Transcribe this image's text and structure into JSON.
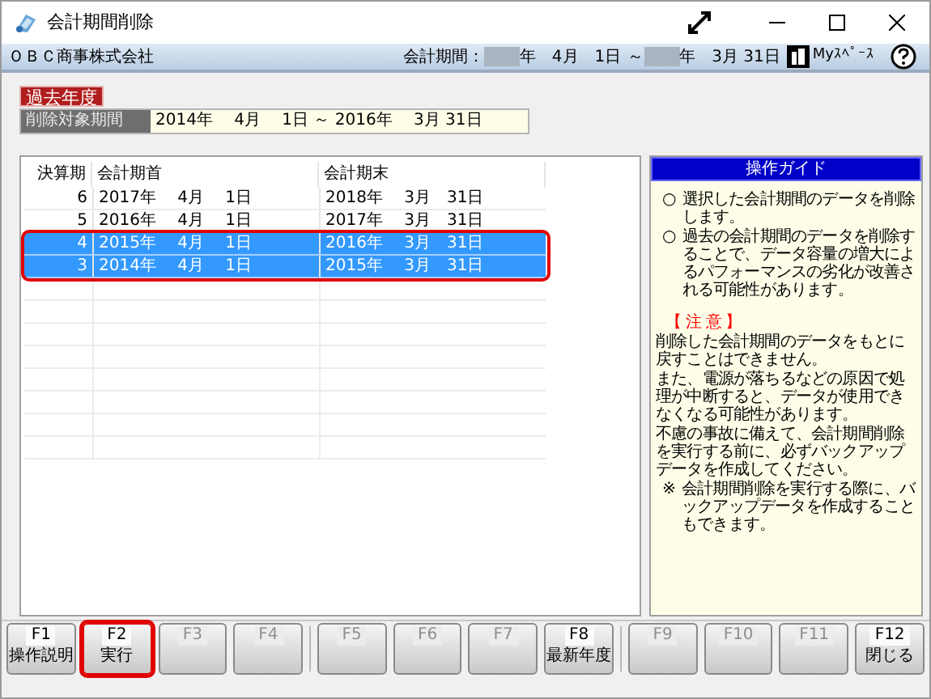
{
  "window": {
    "title": "会計期間削除"
  },
  "header": {
    "company": "ＯＢＣ商事株式会社",
    "period_label": "会計期間：",
    "period_start": "年　4月　1日",
    "period_sep": "～",
    "period_end": "年　3月 31日",
    "myspace": "Myｽﾍﾟｰｽ"
  },
  "badge": "過去年度",
  "target": {
    "label": "削除対象期間",
    "value": "2014年　 4月　 1日 ～ 2016年　 3月 31日"
  },
  "table": {
    "columns": [
      "決算期",
      "会計期首",
      "会計期末"
    ],
    "rows": [
      {
        "period": "6",
        "start": "2017年　 4月　 1日",
        "end": "2018年　 3月　31日",
        "selected": false
      },
      {
        "period": "5",
        "start": "2016年　 4月　 1日",
        "end": "2017年　 3月　31日",
        "selected": false
      },
      {
        "period": "4",
        "start": "2015年　 4月　 1日",
        "end": "2016年　 3月　31日",
        "selected": true
      },
      {
        "period": "3",
        "start": "2014年　 4月　 1日",
        "end": "2015年　 3月　31日",
        "selected": true
      }
    ]
  },
  "guide": {
    "title": "操作ガイド",
    "items": [
      {
        "kind": "bullet",
        "mark": "○",
        "text": "選択した会計期間のデータを削除します。"
      },
      {
        "kind": "bullet",
        "mark": "○",
        "text": "過去の会計期間のデータを削除することで、データ容量の増大によるパフォーマンスの劣化が改善される可能性があります。"
      },
      {
        "kind": "heading",
        "text": "【 注 意 】"
      },
      {
        "kind": "paragraph",
        "text": "削除した会計期間のデータをもとに戻すことはできません。"
      },
      {
        "kind": "paragraph",
        "text": "また、電源が落ちるなどの原因で処理が中断すると、データが使用できなくなる可能性があります。"
      },
      {
        "kind": "paragraph",
        "text": "不慮の事故に備えて、会計期間削除を実行する前に、必ずバックアップデータを作成してください。"
      },
      {
        "kind": "bullet",
        "mark": "※",
        "text": "会計期間削除を実行する際に、バックアップデータを作成することもできます。"
      }
    ]
  },
  "function_keys": [
    {
      "key": "F1",
      "label": "操作説明",
      "disabled": false,
      "highlighted": false
    },
    {
      "key": "F2",
      "label": "実行",
      "disabled": false,
      "highlighted": true
    },
    {
      "key": "F3",
      "disabled": true,
      "highlighted": false
    },
    {
      "key": "F4",
      "disabled": true,
      "highlighted": false
    },
    {
      "key": "F5",
      "disabled": true,
      "highlighted": false
    },
    {
      "key": "F6",
      "disabled": true,
      "highlighted": false
    },
    {
      "key": "F7",
      "disabled": true,
      "highlighted": false
    },
    {
      "key": "F8",
      "label": "最新年度",
      "disabled": false,
      "highlighted": false
    },
    {
      "key": "F9",
      "disabled": true,
      "highlighted": false
    },
    {
      "key": "F10",
      "disabled": true,
      "highlighted": false
    },
    {
      "key": "F11",
      "disabled": true,
      "highlighted": false
    },
    {
      "key": "F12",
      "label": "閉じる",
      "disabled": false,
      "highlighted": false
    }
  ]
}
